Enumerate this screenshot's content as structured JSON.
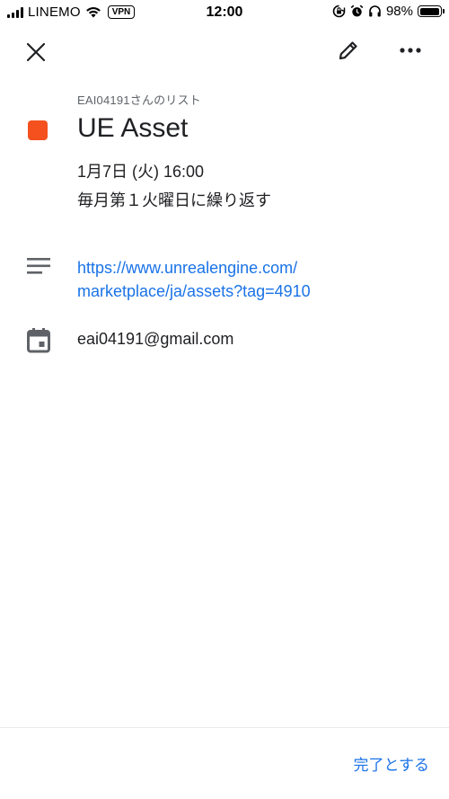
{
  "status_bar": {
    "carrier": "LINEMO",
    "vpn": "VPN",
    "time": "12:00",
    "battery_percent": "98%",
    "battery_level": 0.98,
    "icons": [
      "signal-icon",
      "wifi-icon",
      "rotation-lock-icon",
      "alarm-icon",
      "headphones-icon",
      "battery-icon"
    ]
  },
  "toolbar": {
    "close_icon": "close-icon",
    "edit_icon": "pencil-icon",
    "more_icon": "more-horiz-icon"
  },
  "task": {
    "list_name": "EAI04191さんのリスト",
    "title": "UE Asset",
    "date": "1月7日 (火) 16:00",
    "repeat": "毎月第１火曜日に繰り返す",
    "link_line1": "https://www.unrealengine.com/",
    "link_line2": "marketplace/ja/assets?tag=4910",
    "account": "eai04191@gmail.com",
    "color": "#f4511e"
  },
  "bottom": {
    "complete_label": "完了とする"
  },
  "colors": {
    "accent": "#1a73e8",
    "text": "#202124",
    "secondary": "#5f6368",
    "icon": "#5f6368"
  }
}
